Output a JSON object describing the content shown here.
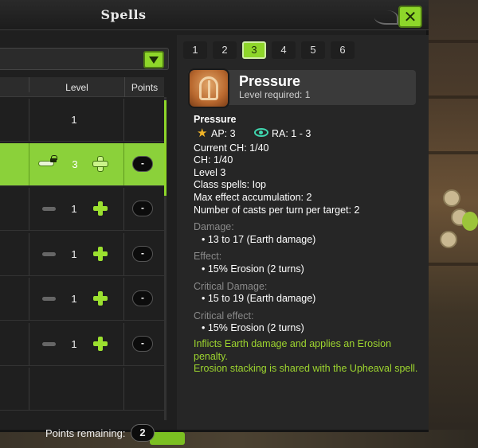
{
  "window": {
    "title": "Spells",
    "close_label": "✕"
  },
  "left": {
    "header": {
      "level": "Level",
      "points": "Points"
    },
    "rows": [
      {
        "level": "1",
        "points": ""
      },
      {
        "level": "3",
        "points": "-"
      },
      {
        "level": "1",
        "points": "-"
      },
      {
        "level": "1",
        "points": "-"
      },
      {
        "level": "1",
        "points": "-"
      },
      {
        "level": "1",
        "points": "-"
      }
    ],
    "points_remaining_label": "Points remaining:",
    "points_remaining_value": "2"
  },
  "right": {
    "tabs": [
      "1",
      "2",
      "3",
      "4",
      "5",
      "6"
    ],
    "active_tab": "3",
    "spell": {
      "name": "Pressure",
      "level_required": "Level required: 1",
      "detail_title": "Pressure",
      "ap": "AP: 3",
      "ra": "RA: 1 - 3",
      "lines": [
        "Current CH: 1/40",
        "CH: 1/40",
        "Level 3",
        "Class spells: Iop",
        "Max effect accumulation: 2",
        "Number of casts per turn per target: 2"
      ],
      "damage_label": "Damage:",
      "damage": "• 13 to 17 (Earth damage)",
      "effect_label": "Effect:",
      "effect": "• 15% Erosion (2 turns)",
      "crit_damage_label": "Critical Damage:",
      "crit_damage": "• 15 to 19 (Earth damage)",
      "crit_effect_label": "Critical effect:",
      "crit_effect": "• 15% Erosion (2 turns)",
      "description_1": "Inflicts Earth damage and applies an Erosion penalty.",
      "description_2": "Erosion stacking is shared with the Upheaval spell."
    }
  },
  "colors": {
    "accent": "#8ed62a",
    "panel": "#262626",
    "description": "#9ed62f"
  }
}
